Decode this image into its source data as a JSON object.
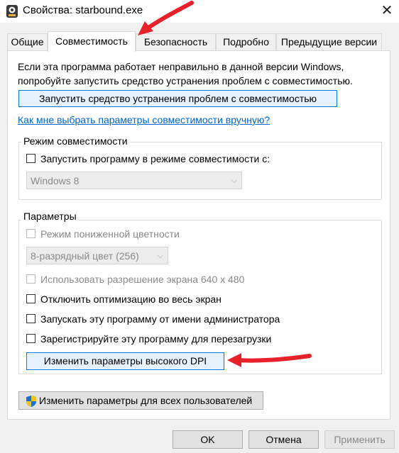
{
  "window": {
    "title": "Свойства: starbound.exe",
    "close": "✕"
  },
  "tabs": [
    {
      "label": "Общие"
    },
    {
      "label": "Совместимость"
    },
    {
      "label": "Безопасность"
    },
    {
      "label": "Подробно"
    },
    {
      "label": "Предыдущие версии"
    }
  ],
  "intro": {
    "line1": "Если эта программа работает неправильно в данной версии Windows,",
    "line2": "попробуйте запустить средство устранения проблем с совместимостью."
  },
  "troubleshoot_button": "Запустить средство устранения проблем с совместимостью",
  "manual_link": "Как мне выбрать параметры совместимости вручную?",
  "compat_mode": {
    "title": "Режим совместимости",
    "checkbox_label": "Запустить программу в режиме совместимости с:",
    "select_value": "Windows 8"
  },
  "settings": {
    "title": "Параметры",
    "reduced_color": "Режим пониженной цветности",
    "color_select": "8-разрядный цвет (256)",
    "res_640": "Использовать разрешение экрана 640 x 480",
    "disable_fullscreen": "Отключить оптимизацию во весь экран",
    "run_as_admin": "Запускать эту программу от имени администратора",
    "register_restart": "Зарегистрируйте эту программу для перезагрузки",
    "dpi_button": "Изменить параметры высокого DPI"
  },
  "all_users_button": "Изменить параметры для всех пользователей",
  "footer": {
    "ok": "OK",
    "cancel": "Отмена",
    "apply": "Применить"
  },
  "colors": {
    "accent": "#0078d7",
    "annotation_arrow": "#e8202a"
  }
}
